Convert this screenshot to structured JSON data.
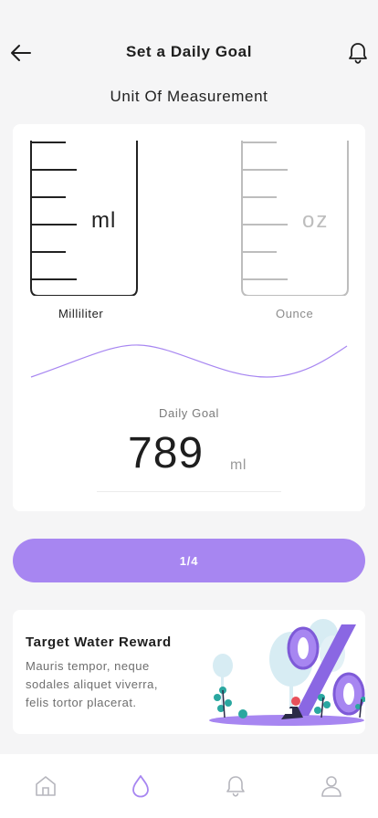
{
  "header": {
    "title": "Set a Daily Goal",
    "back_icon": "arrow-left-icon",
    "notification_icon": "bell-icon"
  },
  "unit_section": {
    "heading": "Unit Of Measurement",
    "options": [
      {
        "symbol": "ml",
        "label": "Milliliter",
        "selected": true
      },
      {
        "symbol": "oz",
        "label": "Ounce",
        "selected": false
      }
    ]
  },
  "daily_goal": {
    "label": "Daily Goal",
    "value": "789",
    "unit": "ml"
  },
  "progress": {
    "label": "1/4",
    "step": 1,
    "total": 4
  },
  "reward": {
    "title": "Target Water Reward",
    "text": "Mauris tempor, neque sodales aliquet viverra, felis tortor placerat.",
    "illustration": "percent-reward-illustration"
  },
  "bottom_nav": [
    {
      "name": "home",
      "icon": "home-icon",
      "active": false
    },
    {
      "name": "water",
      "icon": "water-drop-icon",
      "active": true
    },
    {
      "name": "notifications",
      "icon": "bell-icon",
      "active": false
    },
    {
      "name": "profile",
      "icon": "user-icon",
      "active": false
    }
  ],
  "colors": {
    "accent": "#a786f1",
    "background": "#f5f5f6",
    "card": "#ffffff",
    "text": "#1e1e1e",
    "muted": "#8c8c8c"
  }
}
